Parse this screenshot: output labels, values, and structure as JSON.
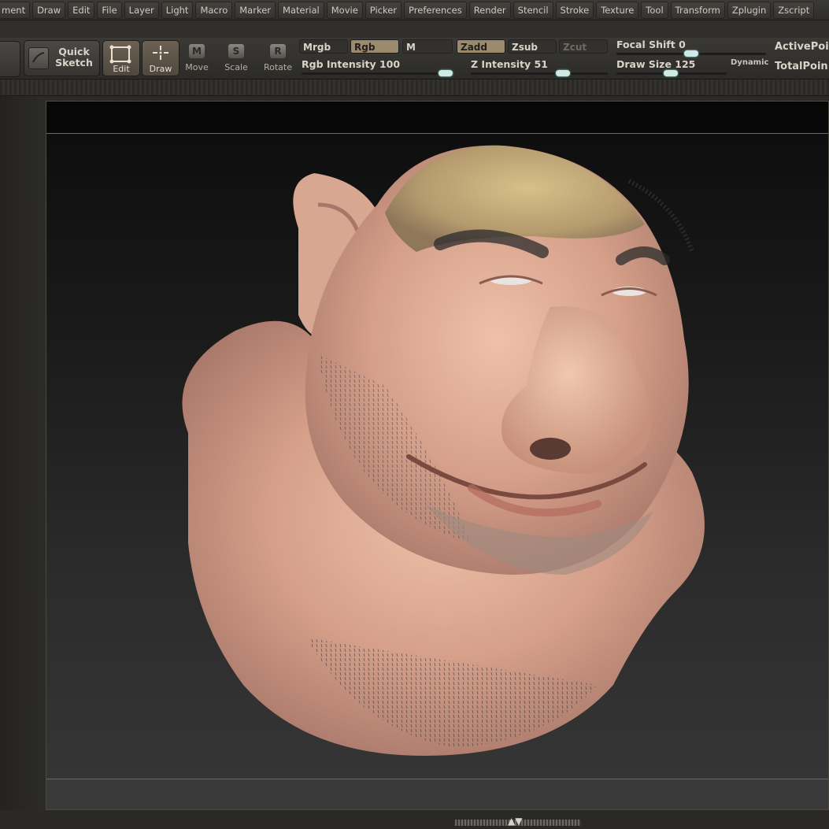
{
  "menu": [
    "ment",
    "Draw",
    "Edit",
    "File",
    "Layer",
    "Light",
    "Macro",
    "Marker",
    "Material",
    "Movie",
    "Picker",
    "Preferences",
    "Render",
    "Stencil",
    "Stroke",
    "Texture",
    "Tool",
    "Transform",
    "Zplugin",
    "Zscript"
  ],
  "toolbar": {
    "quick_sketch": "Quick\nSketch",
    "edit": "Edit",
    "draw": "Draw",
    "move_icon_letter": "M",
    "move": "Move",
    "scale_icon_letter": "S",
    "scale": "Scale",
    "rotate_icon_letter": "R",
    "rotate": "Rotate",
    "mrgb": "Mrgb",
    "rgb": "Rgb",
    "m": "M",
    "zadd": "Zadd",
    "zsub": "Zsub",
    "zcut": "Zcut",
    "rgb_intensity_label": "Rgb Intensity",
    "rgb_intensity_value": "100",
    "z_intensity_label": "Z Intensity",
    "z_intensity_value": "51",
    "focal_shift_label": "Focal Shift",
    "focal_shift_value": "0",
    "draw_size_label": "Draw Size",
    "draw_size_value": "125",
    "dynamic": "Dynamic",
    "active_points": "ActivePoin",
    "total_points": "TotalPoin"
  },
  "colors": {
    "accent_button": "#9a8a6e",
    "slider_thumb": "#cfe9e6",
    "skin_base": "#d9a58c"
  }
}
